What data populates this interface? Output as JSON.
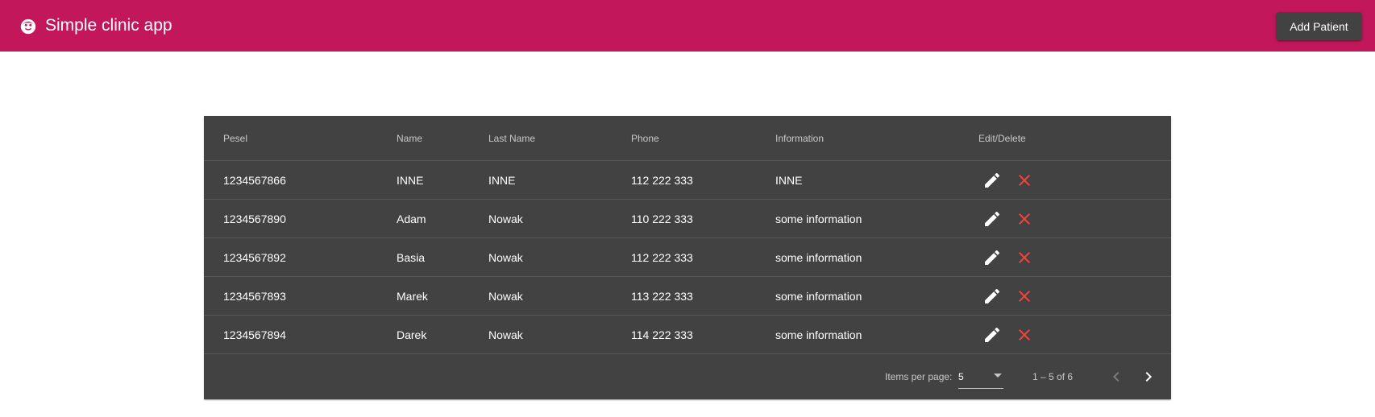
{
  "app": {
    "title": "Simple clinic app",
    "icon": "face-icon",
    "brand_color": "#c2185b",
    "add_patient_label": "Add Patient"
  },
  "table": {
    "headers": {
      "pesel": "Pesel",
      "name": "Name",
      "last_name": "Last Name",
      "phone": "Phone",
      "information": "Information",
      "actions": "Edit/Delete"
    },
    "rows": [
      {
        "pesel": "1234567866",
        "name": "INNE",
        "last_name": "INNE",
        "phone": "112 222 333",
        "information": "INNE"
      },
      {
        "pesel": "1234567890",
        "name": "Adam",
        "last_name": "Nowak",
        "phone": "110 222 333",
        "information": "some information"
      },
      {
        "pesel": "1234567892",
        "name": "Basia",
        "last_name": "Nowak",
        "phone": "112 222 333",
        "information": "some information"
      },
      {
        "pesel": "1234567893",
        "name": "Marek",
        "last_name": "Nowak",
        "phone": "113 222 333",
        "information": "some information"
      },
      {
        "pesel": "1234567894",
        "name": "Darek",
        "last_name": "Nowak",
        "phone": "114 222 333",
        "information": "some information"
      }
    ],
    "edit_icon": "pencil-icon",
    "delete_icon": "close-icon",
    "delete_color": "#f44336"
  },
  "paginator": {
    "items_per_page_label": "Items per page:",
    "items_per_page_value": "5",
    "range_label": "1 – 5 of 6",
    "prev_icon": "chevron-left-icon",
    "next_icon": "chevron-right-icon"
  }
}
